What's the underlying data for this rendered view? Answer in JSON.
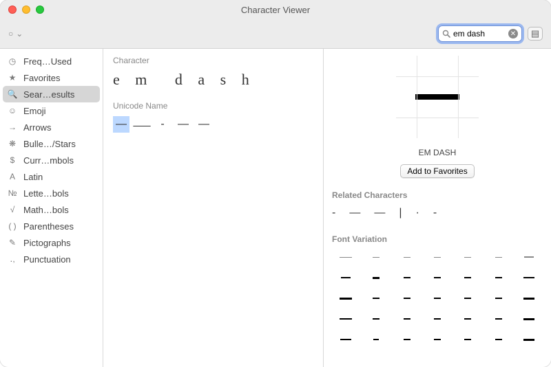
{
  "window": {
    "title": "Character Viewer"
  },
  "toolbar": {
    "menu_glyph": "○",
    "search": {
      "placeholder": "",
      "value": "em dash"
    }
  },
  "sidebar": {
    "items": [
      {
        "icon": "clock-icon",
        "label": "Freq…Used"
      },
      {
        "icon": "star-icon",
        "label": "Favorites"
      },
      {
        "icon": "search-icon",
        "label": "Sear…esults",
        "selected": true
      },
      {
        "icon": "smiley-icon",
        "label": "Emoji"
      },
      {
        "icon": "arrow-icon",
        "label": "Arrows"
      },
      {
        "icon": "snowflake-icon",
        "label": "Bulle…/Stars"
      },
      {
        "icon": "dollar-icon",
        "label": "Curr…mbols"
      },
      {
        "icon": "latin-a-icon",
        "label": "Latin"
      },
      {
        "icon": "numero-icon",
        "label": "Lette…bols"
      },
      {
        "icon": "sqrt-icon",
        "label": "Math…bols"
      },
      {
        "icon": "parens-icon",
        "label": "Parentheses"
      },
      {
        "icon": "pencil-icon",
        "label": "Pictographs"
      },
      {
        "icon": "punct-icon",
        "label": "Punctuation"
      }
    ]
  },
  "center": {
    "character_heading": "Character",
    "character_letters": [
      "e",
      "m",
      "d",
      "a",
      "s",
      "h"
    ],
    "unicode_heading": "Unicode Name",
    "unicode_results": [
      "—",
      "⸺",
      "-",
      "—",
      "—"
    ]
  },
  "details": {
    "name": "EM DASH",
    "add_favorites": "Add to Favorites",
    "related_heading": "Related Characters",
    "related": [
      "-",
      "—",
      "—",
      "|",
      "·",
      "-"
    ],
    "font_variation_heading": "Font Variation",
    "font_variations_widths": [
      [
        18,
        10,
        10,
        10,
        10,
        10,
        14
      ],
      [
        14,
        10,
        10,
        10,
        10,
        10,
        16
      ],
      [
        18,
        10,
        10,
        10,
        10,
        10,
        16
      ],
      [
        18,
        10,
        10,
        10,
        10,
        10,
        16
      ],
      [
        16,
        8,
        10,
        10,
        10,
        10,
        16
      ]
    ],
    "font_variations_weights": [
      [
        1,
        1,
        1,
        1,
        1,
        1,
        2
      ],
      [
        2,
        3,
        2,
        2,
        2,
        2,
        2
      ],
      [
        3,
        2,
        2,
        2,
        2,
        2,
        3
      ],
      [
        2,
        2,
        2,
        2,
        2,
        2,
        3
      ],
      [
        2,
        2,
        2,
        2,
        2,
        2,
        3
      ]
    ]
  },
  "icons": {
    "clock-icon": "◷",
    "star-icon": "★",
    "search-icon": "🔍",
    "smiley-icon": "☺",
    "arrow-icon": "→",
    "snowflake-icon": "❋",
    "dollar-icon": "$",
    "latin-a-icon": "A",
    "numero-icon": "№",
    "sqrt-icon": "√",
    "parens-icon": "( )",
    "pencil-icon": "✎",
    "punct-icon": "․,",
    "chevron-down-icon": "⌄",
    "grid-icon": "▤"
  }
}
